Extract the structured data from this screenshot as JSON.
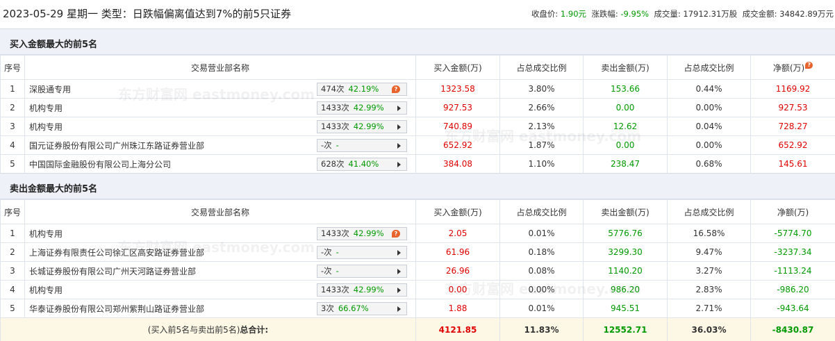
{
  "header": {
    "title": "2023-05-29 星期一 类型：日跌幅偏离值达到7%的前5只证券",
    "close_label": "收盘价:",
    "close_value": "1.90元",
    "change_label": "涨跌幅:",
    "change_value": "-9.95%",
    "volume_label": "成交量:",
    "volume_value": "17912.31万股",
    "turnover_label": "成交金额:",
    "turnover_value": "34842.89万元"
  },
  "watermark_text": "东方财富网 eastmoney.com",
  "columns": {
    "seq": "序号",
    "name": "交易营业部名称",
    "buy": "买入金额(万)",
    "buy_ratio": "占总成交比例",
    "sell": "卖出金额(万)",
    "sell_ratio": "占总成交比例",
    "net": "净额(万)"
  },
  "buy_section": {
    "title": "买入金额最大的前5名",
    "rows": [
      {
        "seq": "1",
        "name": "深股通专用",
        "times": "474次",
        "rate": "42.19%",
        "badge_icon": "question-icon",
        "buy": "1323.58",
        "buy_ratio": "3.80%",
        "sell": "153.66",
        "sell_ratio": "0.44%",
        "net": "1169.92"
      },
      {
        "seq": "2",
        "name": "机构专用",
        "times": "1433次",
        "rate": "42.99%",
        "badge_icon": "arrow-right-icon",
        "buy": "927.53",
        "buy_ratio": "2.66%",
        "sell": "0.00",
        "sell_ratio": "0.00%",
        "net": "927.53"
      },
      {
        "seq": "3",
        "name": "机构专用",
        "times": "1433次",
        "rate": "42.99%",
        "badge_icon": "arrow-right-icon",
        "buy": "740.89",
        "buy_ratio": "2.13%",
        "sell": "12.62",
        "sell_ratio": "0.04%",
        "net": "728.27"
      },
      {
        "seq": "4",
        "name": "国元证券股份有限公司广州珠江东路证券营业部",
        "times": "-次",
        "rate": "-",
        "badge_icon": "arrow-right-icon",
        "buy": "652.92",
        "buy_ratio": "1.87%",
        "sell": "0.00",
        "sell_ratio": "0.00%",
        "net": "652.92"
      },
      {
        "seq": "5",
        "name": "中国国际金融股份有限公司上海分公司",
        "times": "628次",
        "rate": "41.40%",
        "badge_icon": "arrow-right-icon",
        "buy": "384.08",
        "buy_ratio": "1.10%",
        "sell": "238.47",
        "sell_ratio": "0.68%",
        "net": "145.61"
      }
    ]
  },
  "sell_section": {
    "title": "卖出金额最大的前5名",
    "rows": [
      {
        "seq": "1",
        "name": "机构专用",
        "times": "1433次",
        "rate": "42.99%",
        "badge_icon": "question-icon",
        "buy": "2.05",
        "buy_ratio": "0.01%",
        "sell": "5776.76",
        "sell_ratio": "16.58%",
        "net": "-5774.70"
      },
      {
        "seq": "2",
        "name": "上海证券有限责任公司徐汇区高安路证券营业部",
        "times": "-次",
        "rate": "-",
        "badge_icon": "arrow-right-icon",
        "buy": "61.96",
        "buy_ratio": "0.18%",
        "sell": "3299.30",
        "sell_ratio": "9.47%",
        "net": "-3237.34"
      },
      {
        "seq": "3",
        "name": "长城证券股份有限公司广州天河路证券营业部",
        "times": "-次",
        "rate": "-",
        "badge_icon": "arrow-right-icon",
        "buy": "26.96",
        "buy_ratio": "0.08%",
        "sell": "1140.20",
        "sell_ratio": "3.27%",
        "net": "-1113.24"
      },
      {
        "seq": "4",
        "name": "机构专用",
        "times": "1433次",
        "rate": "42.99%",
        "badge_icon": "arrow-right-icon",
        "buy": "0.00",
        "buy_ratio": "0.00%",
        "sell": "986.20",
        "sell_ratio": "2.83%",
        "net": "-986.20"
      },
      {
        "seq": "5",
        "name": "华泰证券股份有限公司郑州紫荆山路证券营业部",
        "times": "3次",
        "rate": "66.67%",
        "badge_icon": "arrow-right-icon",
        "buy": "1.88",
        "buy_ratio": "0.01%",
        "sell": "945.51",
        "sell_ratio": "2.71%",
        "net": "-943.64"
      }
    ]
  },
  "total": {
    "label_prefix": "(买入前5名与卖出前5名)",
    "label_bold": "总合计:",
    "buy": "4121.85",
    "buy_ratio": "11.83%",
    "sell": "12552.71",
    "sell_ratio": "36.03%",
    "net": "-8430.87"
  },
  "colors": {
    "up": "#e00000",
    "down": "#009900",
    "accent": "#e8642c",
    "section_bg": "#eef2f8",
    "total_bg": "#fdf8e6"
  }
}
